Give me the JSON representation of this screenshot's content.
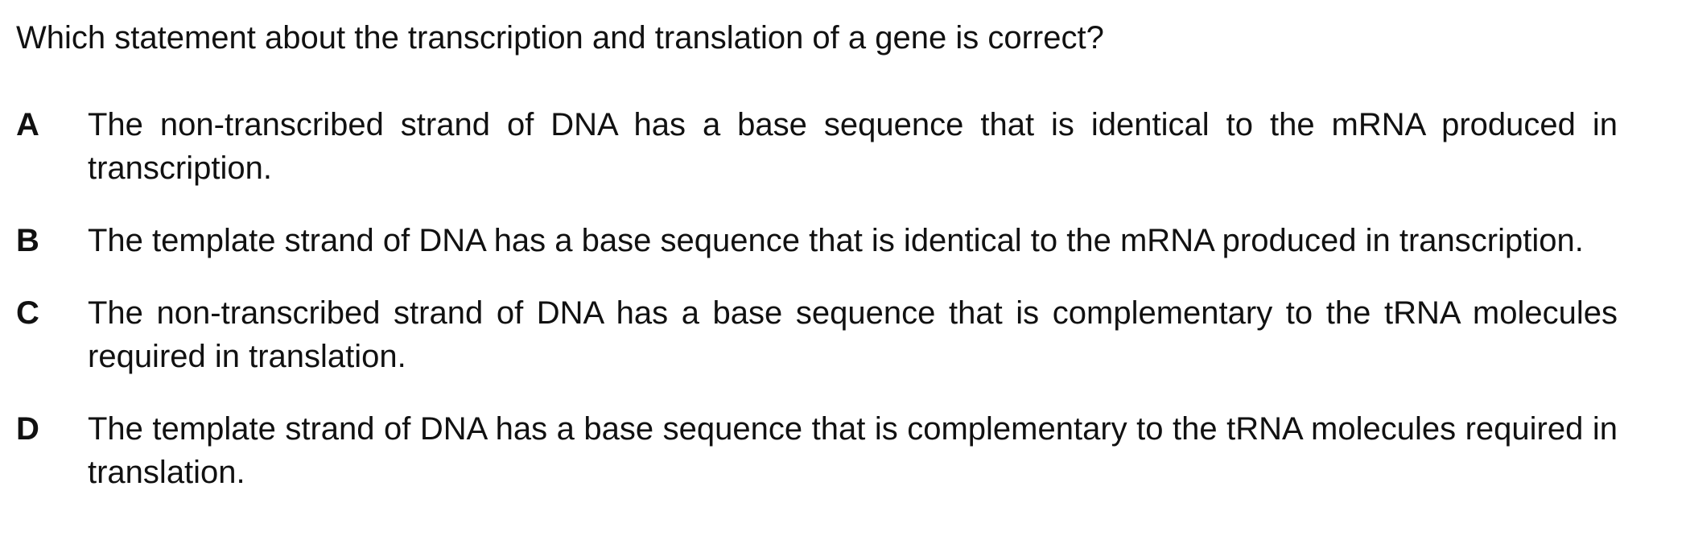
{
  "question": {
    "stem": "Which statement about the transcription and translation of a gene is correct?",
    "options": [
      {
        "letter": "A",
        "text": "The non-transcribed strand of DNA has a base sequence that is identical to the mRNA produced in transcription."
      },
      {
        "letter": "B",
        "text": "The template strand of DNA has a base sequence that is identical to the mRNA produced in transcription."
      },
      {
        "letter": "C",
        "text": "The non-transcribed strand of DNA has a base sequence that is complementary to the tRNA molecules required in translation."
      },
      {
        "letter": "D",
        "text": "The template strand of DNA has a base sequence that is complementary to the tRNA molecules required in translation."
      }
    ]
  }
}
